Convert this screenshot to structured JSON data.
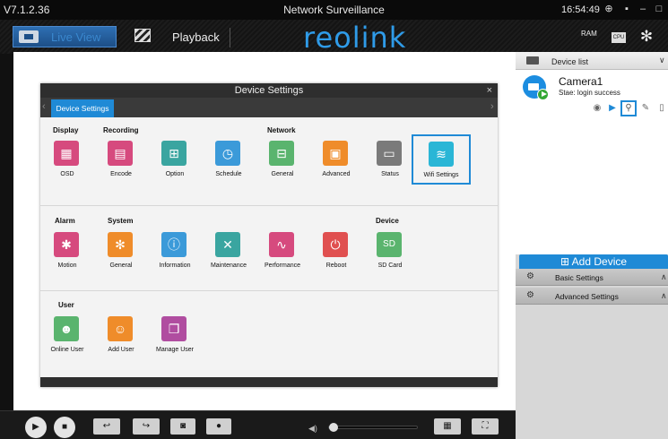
{
  "window": {
    "version": "V7.1.2.36",
    "title": "Network Surveillance",
    "clock": "16:54:49",
    "controls": [
      "network-icon",
      "display-icon",
      "minimize-icon",
      "maximize-icon"
    ]
  },
  "toolbar": {
    "live_view_label": "Live View",
    "playback_label": "Playback",
    "logo_text": "reolink",
    "ram_label": "RAM",
    "cpu_label": "CPU",
    "accent": "#1f8ad6"
  },
  "dialog": {
    "title": "Device Settings",
    "close_glyph": "×",
    "tab_label": "Device Settings",
    "groups": {
      "display": "Display",
      "recording": "Recording",
      "network": "Network",
      "alarm": "Alarm",
      "system": "System",
      "device": "Device",
      "user": "User"
    },
    "items": {
      "osd": "OSD",
      "encode": "Encode",
      "option": "Option",
      "schedule": "Schedule",
      "net_general": "General",
      "advanced": "Advanced",
      "status": "Status",
      "wifi": "Wifi Settings",
      "motion": "Motion",
      "sys_general": "General",
      "information": "Information",
      "maintenance": "Maintenance",
      "performance": "Performance",
      "reboot": "Reboot",
      "sd_card": "SD Card",
      "online_user": "Online User",
      "add_user": "Add User",
      "manage_user": "Manage User"
    },
    "icon_colors": {
      "pink": "#d64a7e",
      "teal": "#3aa5a0",
      "green": "#5ab46e",
      "blue": "#3b9ad9",
      "orange": "#ef8c2a",
      "gray": "#7a7a7a",
      "red": "#e05050",
      "purple": "#b04da0",
      "cyan": "#2ab6d6"
    }
  },
  "device_list": {
    "header": "Device list",
    "camera_name": "Camera1",
    "camera_state": "Stae: login success",
    "add_device": "Add Device",
    "basic_settings": "Basic Settings",
    "advanced_settings": "Advanced Settings"
  },
  "player": {
    "volume_level": 0.05
  }
}
